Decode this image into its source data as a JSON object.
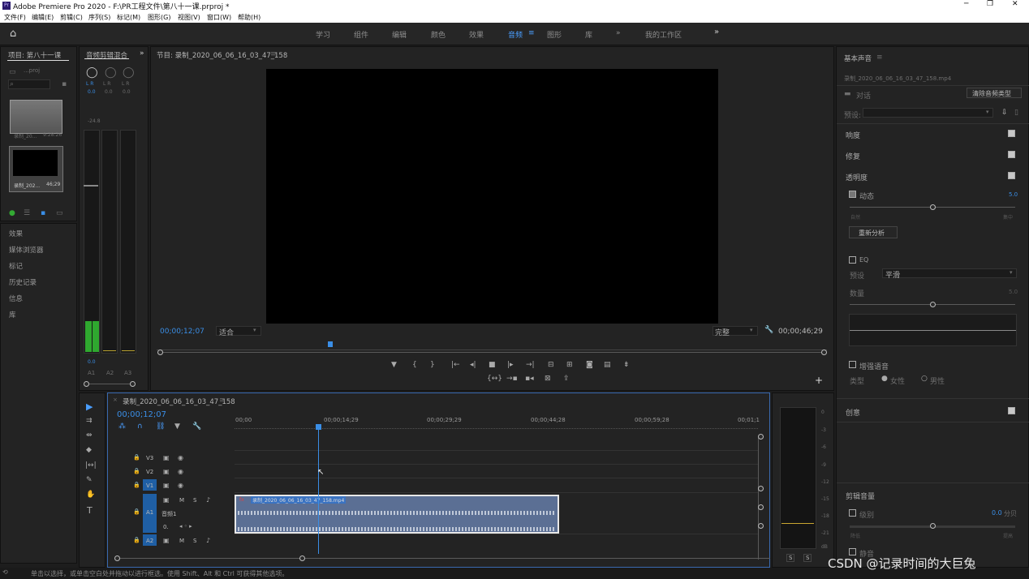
{
  "title_bar": {
    "app_title": "Adobe Premiere Pro 2020 - F:\\PR工程文件\\第八十一课.prproj *"
  },
  "menu": [
    "文件(F)",
    "编辑(E)",
    "剪辑(C)",
    "序列(S)",
    "标记(M)",
    "图形(G)",
    "视图(V)",
    "窗口(W)",
    "帮助(H)"
  ],
  "workspaces": [
    "学习",
    "组件",
    "编辑",
    "颜色",
    "效果",
    "音频",
    "图形",
    "库",
    "»",
    "我的工作区"
  ],
  "active_workspace": "音频",
  "project": {
    "title": "项目: 第八十一课",
    "filename": "...proj",
    "clips": [
      {
        "name": "录制_20...",
        "duration": "9:28:26"
      },
      {
        "name": "录制_202...",
        "duration": "46;29"
      }
    ]
  },
  "left_panels": [
    "效果",
    "媒体浏览器",
    "标记",
    "历史记录",
    "信息",
    "库"
  ],
  "mixer": {
    "title": "音频剪辑混合",
    "values": [
      "0.0",
      "0.0",
      "0.0"
    ],
    "peak": "-24.8",
    "bottom_value": "0.0",
    "channels": [
      "A1",
      "A2",
      "A3"
    ]
  },
  "program": {
    "title": "节目: 录制_2020_06_06_16_03_47_158",
    "timecode": "00;00;12;07",
    "fit": "适合",
    "quality": "完整",
    "duration": "00;00;46;29"
  },
  "timeline": {
    "title": "录制_2020_06_06_16_03_47_158",
    "timecode": "00;00;12;07",
    "ruler": [
      "00;00",
      "00;00;14;29",
      "00;00;29;29",
      "00;00;44;28",
      "00;00;59;28",
      "00;01;1"
    ],
    "tracks": [
      "V3",
      "V2",
      "V1",
      "A1",
      "A2",
      "A3"
    ],
    "a1_label": "音频1",
    "a1_value": "0.",
    "clip_name": "录制_2020_06_06_16_03_47_158.mp4"
  },
  "meter_scale": [
    "0",
    "-3",
    "-6",
    "-9",
    "-12",
    "-15",
    "-18",
    "-21",
    "dB"
  ],
  "essential_sound": {
    "title": "基本声音",
    "clip": "录制_2020_06_06_16_03_47_158.mp4",
    "type": "对话",
    "clear_btn": "清除音频类型",
    "preset_label": "预设:",
    "sections": [
      "响度",
      "修复",
      "透明度"
    ],
    "dynamic_label": "动态",
    "dynamic_value": "5.0",
    "min_label": "自然",
    "max_label": "集中",
    "reanalyze": "重新分析",
    "eq_label": "EQ",
    "eq_preset_label": "预设",
    "eq_preset_value": "平滑",
    "amount_label": "数量",
    "amount_value": "5.0",
    "enhance_label": "增强语音",
    "type_label": "类型",
    "female": "女性",
    "male": "男性",
    "creative": "创意",
    "clip_volume": "剪辑音量",
    "level_label": "级别",
    "level_value": "0.0",
    "level_unit": "分贝",
    "lower": "降低",
    "raise": "提高",
    "mute": "静音"
  },
  "status_text": "单击以选择，或单击空白处并拖动以进行框选。使用 Shift、Alt 和 Ctrl 可获得其他选项。",
  "watermark": "CSDN @记录时间的大巨兔"
}
